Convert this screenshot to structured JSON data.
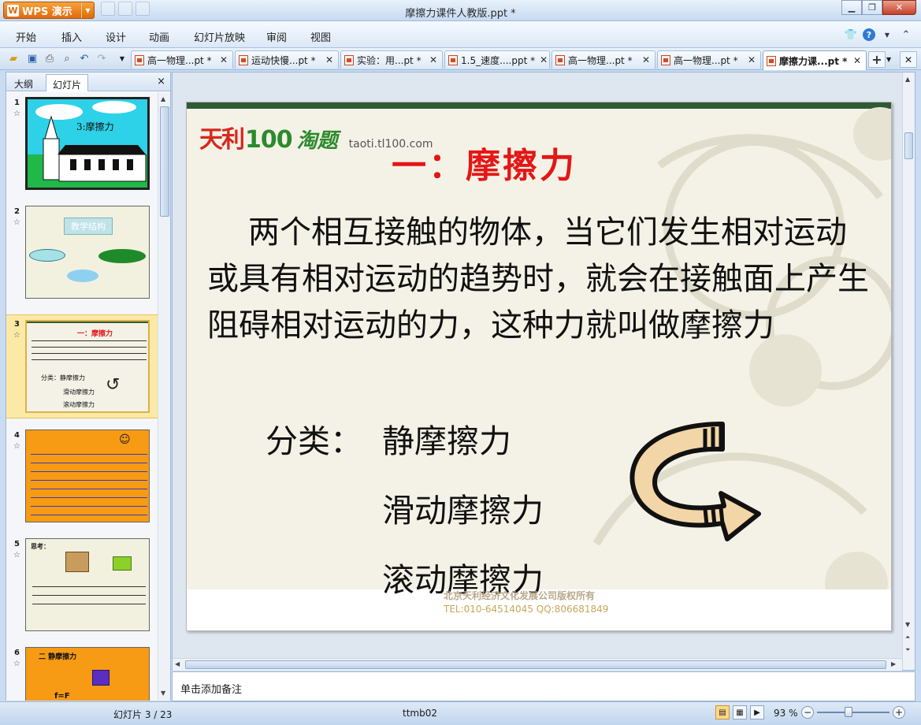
{
  "app": {
    "name": "WPS 演示",
    "logo": "W"
  },
  "window": {
    "title": "摩擦力课件人教版.ppt *"
  },
  "menu": [
    "开始",
    "插入",
    "设计",
    "动画",
    "幻灯片放映",
    "审阅",
    "视图"
  ],
  "doc_tabs": [
    {
      "label": "高一物理...pt *"
    },
    {
      "label": "运动快慢...pt *"
    },
    {
      "label": "实验：用...pt *"
    },
    {
      "label": "1.5_速度....ppt *"
    },
    {
      "label": "高一物理...pt *"
    },
    {
      "label": "高一物理...pt *"
    },
    {
      "label": "摩擦力课...pt *"
    }
  ],
  "left_panel": {
    "tab_outline": "大纲",
    "tab_slides": "幻灯片",
    "close": "×",
    "thumbs": [
      {
        "num": "1",
        "title": "3:摩擦力"
      },
      {
        "num": "2",
        "title": "教学结构"
      },
      {
        "num": "3",
        "title": "一：摩擦力",
        "sub1": "分类：静摩擦力",
        "sub2": "滑动摩擦力",
        "sub3": "滚动摩擦力"
      },
      {
        "num": "4",
        "title": ""
      },
      {
        "num": "5",
        "title": "思考："
      },
      {
        "num": "6",
        "title": "二  静摩擦力",
        "formula": "f=F"
      }
    ]
  },
  "slide": {
    "logo_part1": "天利",
    "logo_part2": "100",
    "logo_part3": "淘题",
    "logo_url": "taoti.tl100.com",
    "title": "一：摩擦力",
    "body": "两个相互接触的物体，当它们发生相对运动或具有相对运动的趋势时，就会在接触面上产生阻碍相对运动的力，这种力就叫做摩擦力",
    "class_label": "分类：",
    "class_1": "静摩擦力",
    "class_2": "滑动摩擦力",
    "class_3": "滚动摩擦力",
    "footer_company": "北京天利经济文化发展公司版权所有",
    "footer_tel": "TEL:010-64514045    QQ:806681849"
  },
  "notes_placeholder": "单击添加备注",
  "status": {
    "slide_indicator": "幻灯片 3 / 23",
    "theme": "ttmb02",
    "zoom": "93 %"
  },
  "colors": {
    "accent_orange": "#e06a0c",
    "slide_title_red": "#e41616",
    "slide_topbar_green": "#2e5a35"
  }
}
